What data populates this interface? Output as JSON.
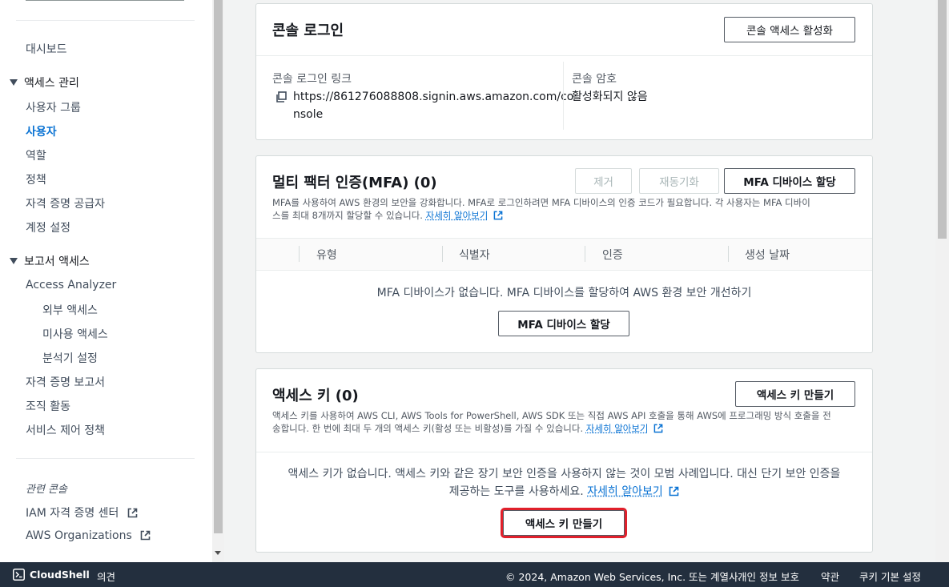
{
  "sidebar": {
    "dashboard": "대시보드",
    "access_mgmt": {
      "label": "액세스 관리",
      "items": [
        "사용자 그룹",
        "사용자",
        "역할",
        "정책",
        "자격 증명 공급자",
        "계정 설정"
      ]
    },
    "reports": {
      "label": "보고서 액세스",
      "analyzer": "Access Analyzer",
      "sub_items": [
        "외부 액세스",
        "미사용 액세스",
        "분석기 설정"
      ],
      "items": [
        "자격 증명 보고서",
        "조직 활동",
        "서비스 제어 정책"
      ]
    },
    "related_title": "관련 콘솔",
    "related": [
      "IAM 자격 증명 센터",
      "AWS Organizations"
    ]
  },
  "console_login": {
    "title": "콘솔 로그인",
    "enable_button": "콘솔 액세스 활성화",
    "link_label": "콘솔 로그인 링크",
    "link_line1": "https://861276088808.signin.aws.amazon.com/co",
    "link_line2": "nsole",
    "password_label": "콘솔 암호",
    "password_value": "활성화되지 않음"
  },
  "mfa": {
    "title": "멀티 팩터 인증(MFA) (0)",
    "remove_button": "제거",
    "resync_button": "재동기화",
    "assign_button": "MFA 디바이스 할당",
    "desc_line1": "MFA를 사용하여 AWS 환경의 보안을 강화합니다. MFA로 로그인하려면 MFA 디바이스의 인증 코드가 필요합니다. 각 사용자는 MFA 디바이",
    "desc_line2": "스를 최대 8개까지 할당할 수 있습니다.",
    "learn_more": "자세히 알아보기",
    "columns": [
      "유형",
      "식별자",
      "인증",
      "생성 날짜"
    ],
    "empty_text": "MFA 디바이스가 없습니다. MFA 디바이스를 할당하여 AWS 환경 보안 개선하기",
    "empty_button": "MFA 디바이스 할당"
  },
  "access_keys": {
    "title": "액세스 키 (0)",
    "create_button": "액세스 키 만들기",
    "desc_line1": "액세스 키를 사용하여 AWS CLI, AWS Tools for PowerShell, AWS SDK 또는 직접 AWS API 호출을 통해 AWS에 프로그래밍 방식 호출을 전",
    "desc_line2": "송합니다. 한 번에 최대 두 개의 액세스 키(활성 또는 비활성)를 가질 수 있습니다.",
    "learn_more": "자세히 알아보기",
    "empty_line1": "액세스 키가 없습니다. 액세스 키와 같은 장기 보안 인증을 사용하지 않는 것이 모범 사례입니다. 대신 단기 보안 인증을",
    "empty_line2": "제공하는 도구를 사용하세요.",
    "empty_learn_more": "자세히 알아보기",
    "empty_button": "액세스 키 만들기"
  },
  "bottombar": {
    "cloudshell": "CloudShell",
    "feedback": "의견",
    "copyright": "© 2024, Amazon Web Services, Inc. 또는 계열사.",
    "privacy": "개인 정보 보호",
    "terms": "약관",
    "cookies": "쿠키 기본 설정"
  },
  "colors": {
    "link": "#0972d3",
    "highlight": "#e0202b",
    "bottombar": "#232f3e"
  }
}
